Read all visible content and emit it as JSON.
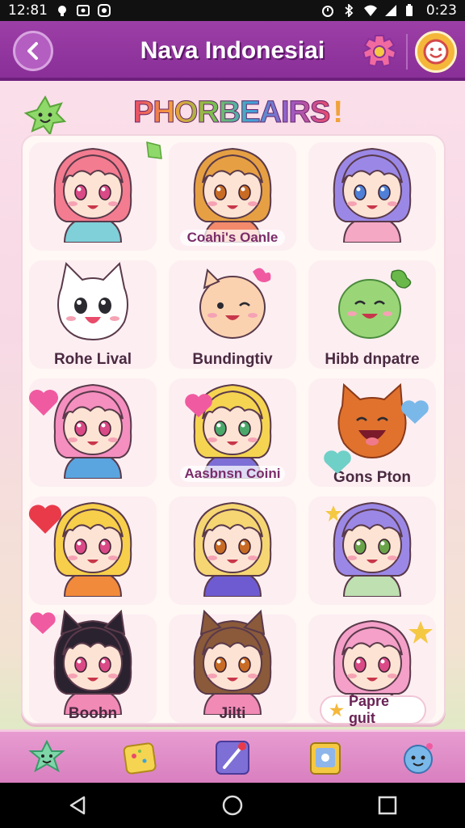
{
  "status_bar": {
    "time_left": "12:81",
    "time_right": "0:23"
  },
  "app_bar": {
    "title": "Nava Indonesiai"
  },
  "banner": {
    "title": "PHORBEAIRS",
    "exclaim": "!"
  },
  "grid": {
    "cells": [
      {
        "label": "",
        "hair": "#f47c90",
        "eyes": "#d94a86",
        "shirt": "#7fd0d9"
      },
      {
        "label": "Coahi's Oanle",
        "hair": "#e6a043",
        "eyes": "#c86b24",
        "shirt": "#f28a6b",
        "pill": true
      },
      {
        "label": "",
        "hair": "#9b88e6",
        "eyes": "#4f7fd6",
        "shirt": "#f4a8c4"
      },
      {
        "label": "Rohe Lival",
        "kind": "cat"
      },
      {
        "label": "Bundingtiv",
        "kind": "bun"
      },
      {
        "label": "Hibb dnpatre",
        "kind": "blob"
      },
      {
        "label": "",
        "hair": "#f48fbf",
        "eyes": "#d94a86",
        "shirt": "#5aa5e0"
      },
      {
        "label": "Aasbnsn Coini",
        "hair": "#f5d451",
        "eyes": "#4aa86a",
        "shirt": "#7d6fd6",
        "pill": true
      },
      {
        "label": "Gons Pton",
        "kind": "fox"
      },
      {
        "label": "",
        "hair": "#f7cf4a",
        "eyes": "#d94a86",
        "shirt": "#f28a3b"
      },
      {
        "label": "",
        "hair": "#f5d672",
        "eyes": "#c86b24",
        "shirt": "#6f5bd1"
      },
      {
        "label": "",
        "hair": "#9b88e6",
        "eyes": "#6aa44a",
        "shirt": "#bfe0b0"
      },
      {
        "label": "Boobn",
        "hair": "#2b2230",
        "eyes": "#d94a86",
        "shirt": "#f28ab6",
        "ears": true
      },
      {
        "label": "Jilti",
        "hair": "#8a5a3a",
        "eyes": "#c86b24",
        "shirt": "#f28ab6",
        "ears": true
      },
      {
        "label": "",
        "hair": "#f4a0c8",
        "eyes": "#d94a86",
        "shirt": "#fff"
      }
    ]
  },
  "badge": {
    "label": "Papre guit"
  },
  "bottom_nav": {
    "items": [
      {
        "name": "star-friend-icon"
      },
      {
        "name": "sticker-icon"
      },
      {
        "name": "brush-icon"
      },
      {
        "name": "frame-icon"
      },
      {
        "name": "buddy-icon"
      }
    ]
  },
  "colors": {
    "app_bar": "#8a2f98",
    "accent": "#f4b73a",
    "nav": "#d97fc0"
  }
}
